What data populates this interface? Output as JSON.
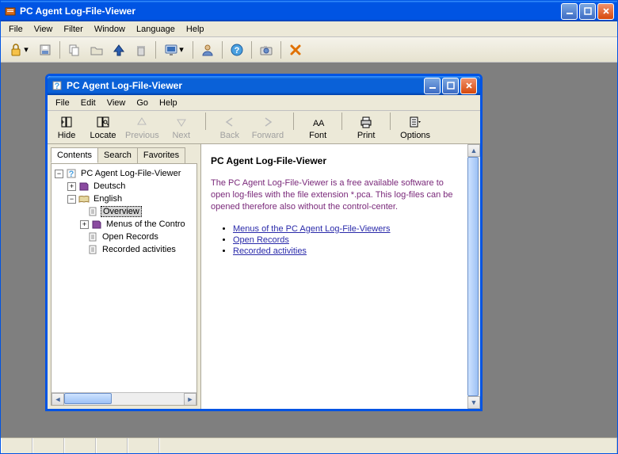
{
  "outer": {
    "title": "PC Agent Log-File-Viewer",
    "menu": [
      "File",
      "View",
      "Filter",
      "Window",
      "Language",
      "Help"
    ],
    "win_btns": {
      "min": "_",
      "max": "□",
      "close": "✕"
    }
  },
  "outer_toolbar": {
    "items": [
      {
        "name": "lock-icon"
      },
      {
        "name": "save-icon"
      },
      {
        "sep": true
      },
      {
        "name": "copy-icon"
      },
      {
        "name": "folder-icon"
      },
      {
        "name": "up-icon"
      },
      {
        "name": "delete-icon"
      },
      {
        "sep": true
      },
      {
        "name": "screen-icon"
      },
      {
        "sep": true
      },
      {
        "name": "user-icon"
      },
      {
        "sep": true
      },
      {
        "name": "help-icon"
      },
      {
        "sep": true
      },
      {
        "name": "camera-icon"
      },
      {
        "sep": true
      },
      {
        "name": "close-file-icon"
      }
    ]
  },
  "inner": {
    "title": "PC Agent Log-File-Viewer",
    "menu": [
      "File",
      "Edit",
      "View",
      "Go",
      "Help"
    ],
    "toolbar": [
      {
        "name": "hide",
        "label": "Hide",
        "enabled": true
      },
      {
        "name": "locate",
        "label": "Locate",
        "enabled": true
      },
      {
        "name": "previous",
        "label": "Previous",
        "enabled": false
      },
      {
        "name": "next",
        "label": "Next",
        "enabled": false
      },
      {
        "sep": true
      },
      {
        "name": "back",
        "label": "Back",
        "enabled": false
      },
      {
        "name": "forward",
        "label": "Forward",
        "enabled": false
      },
      {
        "sep": true
      },
      {
        "name": "font",
        "label": "Font",
        "enabled": true
      },
      {
        "sep": true
      },
      {
        "name": "print",
        "label": "Print",
        "enabled": true
      },
      {
        "sep": true
      },
      {
        "name": "options",
        "label": "Options",
        "enabled": true
      }
    ],
    "tabs": [
      "Contents",
      "Search",
      "Favorites"
    ],
    "active_tab": 0,
    "tree": {
      "root": "PC Agent Log-File-Viewer",
      "children": [
        {
          "label": "Deutsch",
          "type": "book",
          "expanded": false,
          "children": true
        },
        {
          "label": "English",
          "type": "book",
          "expanded": true,
          "children": [
            {
              "label": "Overview",
              "type": "page",
              "selected": true
            },
            {
              "label": "Menus of the Contro",
              "type": "book",
              "expanded": false,
              "children": true
            },
            {
              "label": "Open Records",
              "type": "page"
            },
            {
              "label": "Recorded activities",
              "type": "page"
            }
          ]
        }
      ]
    }
  },
  "content": {
    "heading": "PC Agent Log-File-Viewer",
    "paragraph": "The PC Agent Log-File-Viewer is a free available software to open log-files with the file extension *.pca. This log-files can be opened therefore also without the control-center.",
    "links": [
      "Menus of the PC Agent Log-File-Viewers",
      "Open Records",
      "Recorded activities"
    ]
  }
}
